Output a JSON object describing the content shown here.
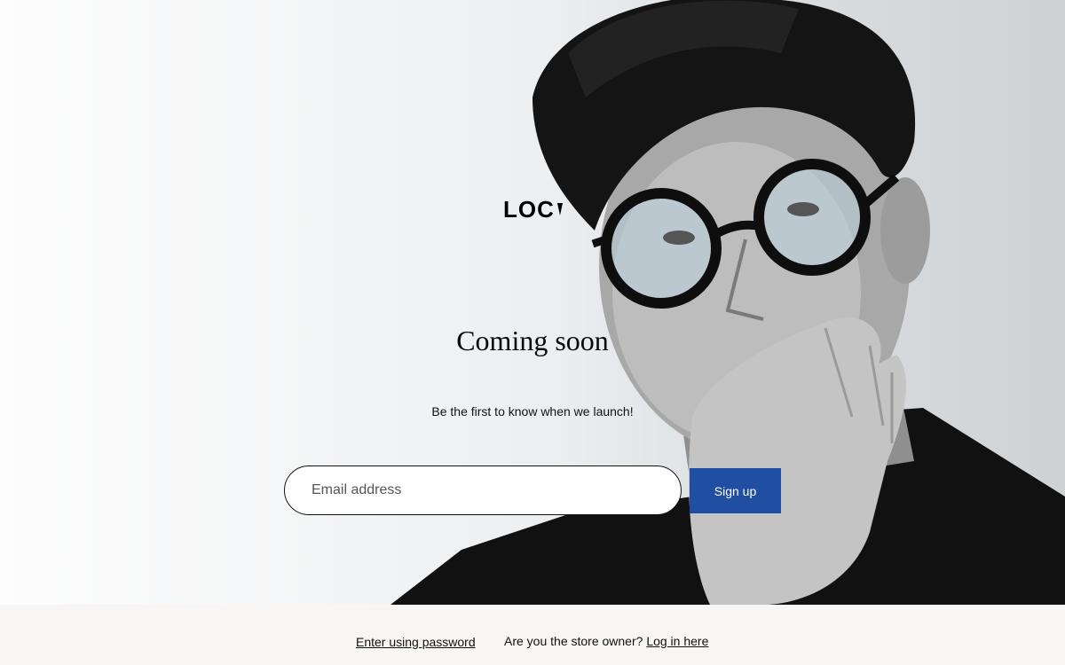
{
  "brand": {
    "logo_text": "LOC"
  },
  "hero": {
    "title": "Coming soon",
    "subtitle": "Be the first to know when we launch!"
  },
  "signup_form": {
    "email_placeholder": "Email address",
    "email_value": "",
    "button_label": "Sign up",
    "button_color": "#1f4ea3"
  },
  "footer": {
    "enter_password_link": "Enter using password",
    "owner_prompt": "Are you the store owner?",
    "login_link": "Log in here"
  }
}
